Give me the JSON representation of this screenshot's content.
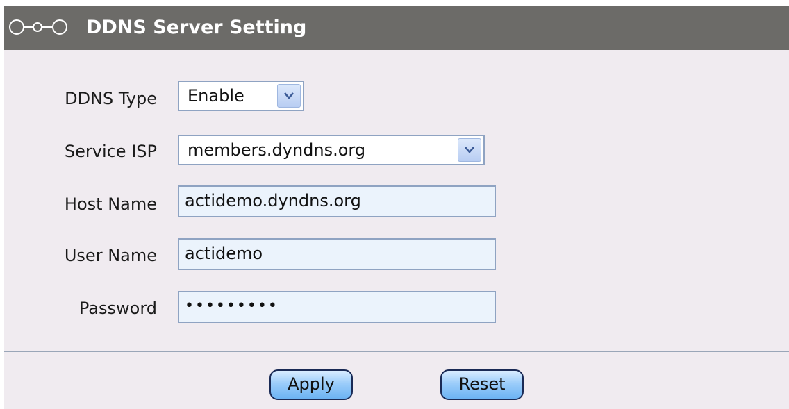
{
  "header": {
    "title": "DDNS Server Setting",
    "icon": "chain-link-icon"
  },
  "form": {
    "ddns_type": {
      "label": "DDNS Type",
      "value": "Enable"
    },
    "service_isp": {
      "label": "Service ISP",
      "value": "members.dyndns.org"
    },
    "host_name": {
      "label": "Host Name",
      "value": "actidemo.dyndns.org"
    },
    "user_name": {
      "label": "User Name",
      "value": "actidemo"
    },
    "password": {
      "label": "Password",
      "value": "•••••••••"
    }
  },
  "buttons": {
    "apply": "Apply",
    "reset": "Reset"
  },
  "colors": {
    "titlebar_bg": "#6c6b68",
    "panel_bg": "#f0ebf0",
    "input_bg": "#ebf3fc",
    "button_blue": "#9ccdfa"
  }
}
